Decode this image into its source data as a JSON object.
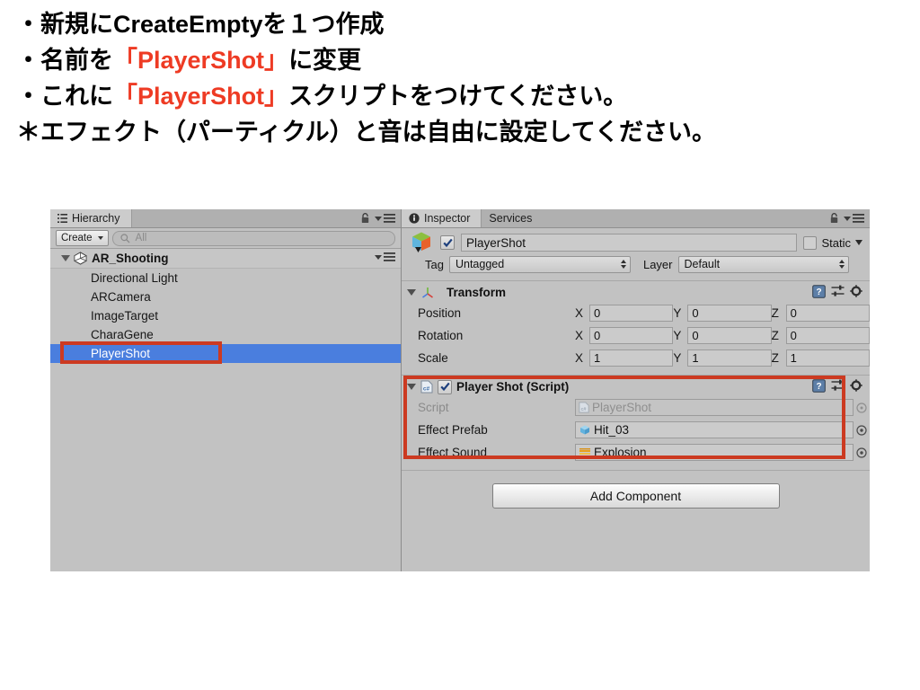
{
  "slide": {
    "lines": [
      {
        "parts": [
          {
            "t": "・新規にCreateEmptyを１つ作成",
            "hl": false
          }
        ]
      },
      {
        "parts": [
          {
            "t": "・名前を",
            "hl": false
          },
          {
            "t": "「PlayerShot」",
            "hl": true
          },
          {
            "t": "に変更",
            "hl": false
          }
        ]
      },
      {
        "parts": [
          {
            "t": "・これに",
            "hl": false
          },
          {
            "t": "「PlayerShot」",
            "hl": true
          },
          {
            "t": "スクリプトをつけてください。",
            "hl": false
          }
        ]
      },
      {
        "parts": [
          {
            "t": "＊エフェクト（パーティクル）と音は自由に設定してください。",
            "hl": false
          }
        ]
      }
    ]
  },
  "colors": {
    "highlight_red": "#cc3a21",
    "selection_blue": "#4a7ede",
    "panel_gray": "#c2c2c2",
    "accent_text_red": "#ee3b24"
  },
  "hierarchy": {
    "tab_label": "Hierarchy",
    "tab_icon": "hierarchy-list-icon",
    "lock_icon": "lock-icon",
    "menu_icon": "panel-menu-icon",
    "create_button": "Create",
    "search_placeholder": "All",
    "search_icon": "search-icon",
    "root": {
      "label": "AR_Shooting",
      "icon": "unity-logo-icon"
    },
    "items": [
      {
        "label": "Directional Light",
        "selected": false
      },
      {
        "label": "ARCamera",
        "selected": false
      },
      {
        "label": "ImageTarget",
        "selected": false
      },
      {
        "label": "CharaGene",
        "selected": false
      },
      {
        "label": "PlayerShot",
        "selected": true
      }
    ]
  },
  "inspector": {
    "tabs": [
      {
        "label": "Inspector",
        "active": true,
        "icon": "info-icon"
      },
      {
        "label": "Services",
        "active": false,
        "icon": ""
      }
    ],
    "lock_icon": "lock-icon",
    "menu_icon": "panel-menu-icon",
    "gameobject": {
      "icon": "gameobject-cube-icon",
      "enabled": true,
      "name": "PlayerShot",
      "static_label": "Static",
      "static_checked": false,
      "tag_label": "Tag",
      "tag_value": "Untagged",
      "layer_label": "Layer",
      "layer_value": "Default"
    },
    "transform": {
      "title": "Transform",
      "icon": "transform-axis-icon",
      "help_icon": "help-book-icon",
      "preset_icon": "preset-slider-icon",
      "gear_icon": "gear-icon",
      "rows": [
        {
          "label": "Position",
          "x": "0",
          "y": "0",
          "z": "0"
        },
        {
          "label": "Rotation",
          "x": "0",
          "y": "0",
          "z": "0"
        },
        {
          "label": "Scale",
          "x": "1",
          "y": "1",
          "z": "1"
        }
      ],
      "axis_labels": [
        "X",
        "Y",
        "Z"
      ]
    },
    "script_component": {
      "title": "Player Shot (Script)",
      "icon": "csharp-script-icon",
      "enabled": true,
      "help_icon": "help-book-icon",
      "preset_icon": "preset-slider-icon",
      "gear_icon": "gear-icon",
      "fields": [
        {
          "label": "Script",
          "value": "PlayerShot",
          "value_icon": "csharp-script-icon",
          "disabled": true,
          "picker_icon": "object-picker-icon"
        },
        {
          "label": "Effect Prefab",
          "value": "Hit_03",
          "value_icon": "prefab-cube-icon",
          "disabled": false,
          "picker_icon": "object-picker-icon"
        },
        {
          "label": "Effect Sound",
          "value": "Explosion",
          "value_icon": "audioclip-icon",
          "disabled": false,
          "picker_icon": "object-picker-icon"
        }
      ]
    },
    "add_component_label": "Add Component"
  }
}
